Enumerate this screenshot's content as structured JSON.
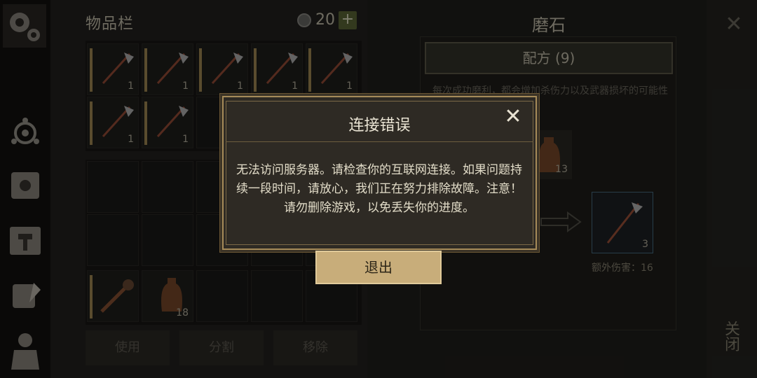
{
  "inventory": {
    "title": "物品栏",
    "currency_icon": "coin-icon",
    "currency_count": "20",
    "add_label": "+",
    "rows": [
      [
        {
          "icon": "halberd-icon",
          "qty": "1"
        },
        {
          "icon": "halberd-icon",
          "qty": "1"
        },
        {
          "icon": "halberd-icon",
          "qty": "1"
        },
        {
          "icon": "halberd-icon",
          "qty": "1"
        },
        {
          "icon": "halberd-icon",
          "qty": "1"
        }
      ],
      [
        {
          "icon": "halberd-icon",
          "qty": "1"
        },
        {
          "icon": "halberd-icon",
          "qty": "1"
        }
      ]
    ],
    "bottom_items": [
      {
        "icon": "spiked-club-icon",
        "qty": ""
      },
      {
        "icon": "bottle-icon",
        "qty": "18"
      }
    ],
    "buttons": {
      "use": "使用",
      "split": "分割",
      "remove": "移除"
    }
  },
  "grindstone": {
    "title": "磨石",
    "recipe_label": "配方 (9)",
    "description": "每次成功磨利，都会增加杀伤力以及武器损坏的可能性",
    "input_qty": "13",
    "result_qty": "3",
    "extra_damage": "额外伤害：16"
  },
  "close_label": "关闭",
  "dialog": {
    "title": "连接错误",
    "body": "无法访问服务器。请检查你的互联网连接。如果问题持续一段时间，请放心，我们正在努力排除故障。注意！请勿删除游戏，以免丢失你的进度。",
    "exit_label": "退出"
  },
  "colors": {
    "accent": "#a68b59",
    "button": "#c8ad7a",
    "plus": "#5d6838",
    "result_border": "#4a6f86"
  }
}
